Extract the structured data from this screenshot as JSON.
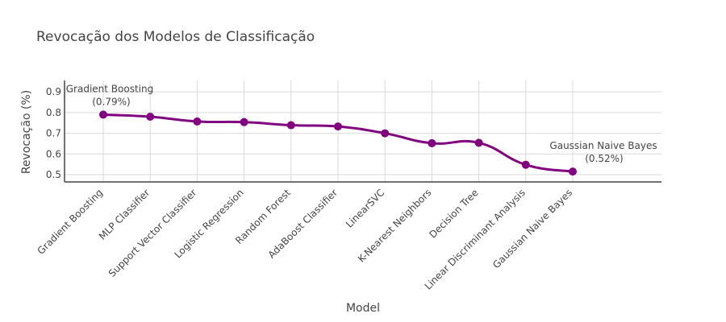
{
  "chart_data": {
    "type": "line",
    "title": "Revocação dos Modelos de Classificação",
    "xlabel": "Model",
    "ylabel": "Revocação (%)",
    "ylim": [
      0.465,
      0.955
    ],
    "yticks": [
      "0.5",
      "0.6",
      "0.7",
      "0.8",
      "0.9"
    ],
    "grid": true,
    "line_color": "#800080",
    "categories": [
      "Gradient Boosting",
      "MLP Classifier",
      "Support Vector Classifier",
      "Logistic Regression",
      "Random Forest",
      "AdaBoost Classifier",
      "LinearSVC",
      "K-Nearest Neighbors",
      "Decision Tree",
      "Linear Discriminant Analysis",
      "Gaussian Naive Bayes"
    ],
    "values": [
      0.79,
      0.78,
      0.757,
      0.754,
      0.739,
      0.733,
      0.7,
      0.652,
      0.654,
      0.548,
      0.515
    ],
    "annotations": [
      {
        "category": "Gradient Boosting",
        "line1": "Gradient Boosting",
        "line2": "(0.79%)"
      },
      {
        "category": "Gaussian Naive Bayes",
        "line1": "Gaussian Naive Bayes",
        "line2": "(0.52%)"
      }
    ]
  }
}
